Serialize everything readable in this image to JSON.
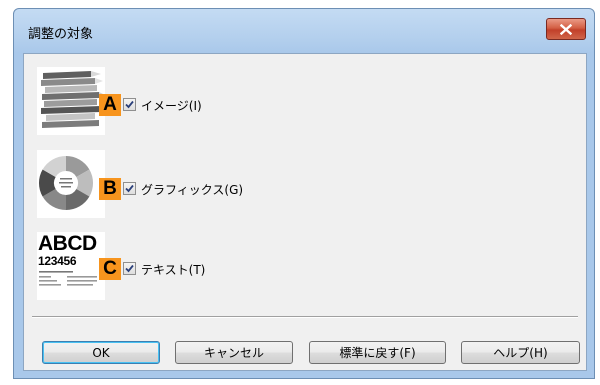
{
  "dialog": {
    "title": "調整の対象",
    "close_icon": "close-icon"
  },
  "options": [
    {
      "marker": "A",
      "label": "イメージ(I)",
      "checked": true,
      "thumb_icon": "image-thumbnail"
    },
    {
      "marker": "B",
      "label": "グラフィックス(G)",
      "checked": true,
      "thumb_icon": "graphics-thumbnail"
    },
    {
      "marker": "C",
      "label": "テキスト(T)",
      "checked": true,
      "thumb_icon": "text-thumbnail"
    }
  ],
  "text_thumbnail": {
    "line1": "ABCD",
    "line2": "123456"
  },
  "buttons": {
    "ok": "OK",
    "cancel": "キャンセル",
    "restore": "標準に戻す(F)",
    "help": "ヘルプ(H)"
  },
  "colors": {
    "marker": "#f7941d",
    "close_button": "#c9472f"
  }
}
